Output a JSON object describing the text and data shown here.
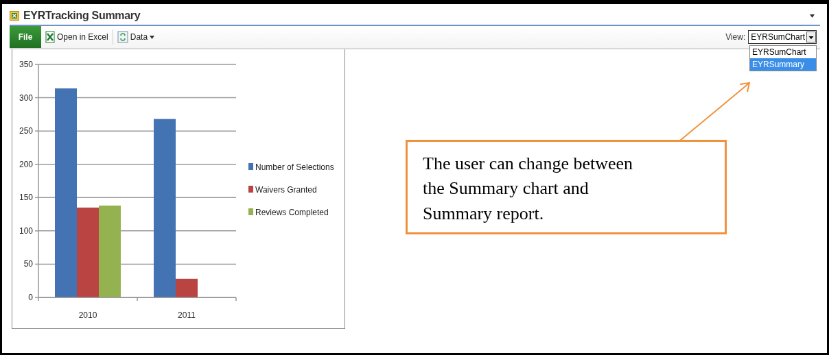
{
  "window": {
    "title": "EYRTracking Summary"
  },
  "toolbar": {
    "file_button": "File",
    "buttons": [
      {
        "kind": "excel",
        "label": "Open in Excel"
      },
      {
        "kind": "data",
        "label": "Data"
      }
    ]
  },
  "view_selector": {
    "label": "View:",
    "value": "EYRSumChart",
    "options": [
      {
        "label": "EYRSumChart",
        "highlighted": false
      },
      {
        "label": "EYRSummary",
        "highlighted": true
      }
    ]
  },
  "chart": {
    "chart_data": {
      "type": "bar",
      "grid": true,
      "legend": true,
      "categories": [
        "2010",
        "2011"
      ],
      "ylim": [
        0,
        350
      ],
      "yticks": [
        0,
        50,
        100,
        150,
        200,
        250,
        300,
        350
      ],
      "series": [
        {
          "name": "Number of Selections",
          "color": "#4473b3",
          "values": [
            314,
            268
          ]
        },
        {
          "name": "Waivers Granted",
          "color": "#b94441",
          "values": [
            135,
            28
          ]
        },
        {
          "name": "Reviews Completed",
          "color": "#94b24f",
          "values": [
            138,
            null
          ]
        }
      ]
    }
  },
  "callout": {
    "text": "The user can change between the Summary chart and Summary report."
  }
}
